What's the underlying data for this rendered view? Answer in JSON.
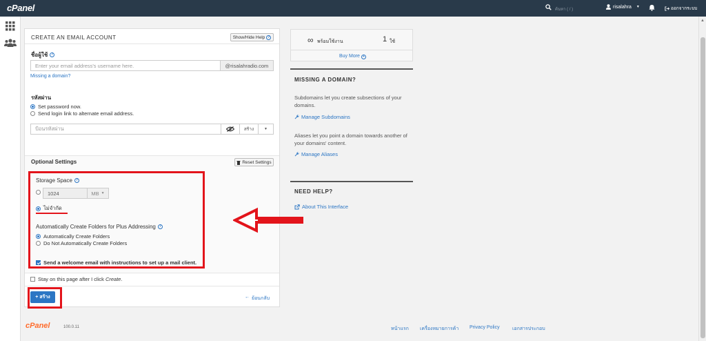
{
  "topbar": {
    "logo": "cPanel",
    "search_placeholder": "ค้นหา ( / )",
    "username": "risalahra",
    "logout": "ออกจากระบบ"
  },
  "form": {
    "title": "CREATE AN EMAIL ACCOUNT",
    "show_hide_help": "Show/Hide Help",
    "username_label": "ชื่อผู้ใช้",
    "username_placeholder": "Enter your email address's username here.",
    "domain": "@risalahradio.com",
    "missing_domain_link": "Missing a domain?",
    "password_label": "รหัสผ่าน",
    "set_password_now": "Set password now.",
    "send_login_link": "Send login link to alternate email address.",
    "password_placeholder": "ป้อนรหัสผ่าน",
    "generate_label": "สร้าง",
    "optional_settings": "Optional Settings",
    "reset_settings": "Reset Settings",
    "storage_label": "Storage Space",
    "storage_value": "1024",
    "storage_unit": "MB",
    "unlimited_label": "ไม่จำกัด",
    "auto_folders_label": "Automatically Create Folders for Plus Addressing",
    "auto_create": "Automatically Create Folders",
    "no_auto_create": "Do Not Automatically Create Folders",
    "welcome_email": "Send a welcome email with instructions to set up a mail client.",
    "stay_on_page_prefix": "Stay on this page after I click ",
    "stay_on_page_em": "Create",
    "stay_on_page_suffix": ".",
    "create_button": "สร้าง",
    "back_link": "ย้อนกลับ"
  },
  "sidebar": {
    "available_label": "พร้อมใช้งาน",
    "used_count": "1",
    "used_unit": "ใช้",
    "buy_more": "Buy More",
    "missing_domain_head": "MISSING A DOMAIN?",
    "subdomains_text": "Subdomains let you create subsections of your domains.",
    "manage_subdomains": "Manage Subdomains",
    "aliases_text": "Aliases let you point a domain towards another of your domains' content.",
    "manage_aliases": "Manage Aliases",
    "need_help_head": "NEED HELP?",
    "about_interface": "About This Interface"
  },
  "footer": {
    "logo": "cPanel",
    "version": "100.0.11",
    "links": [
      "หน้าแรก",
      "เครื่องหมายการค้า",
      "Privacy Policy",
      "เอกสารประกอบ"
    ]
  },
  "colors": {
    "topbar": "#293a4a",
    "primary": "#2c76c4",
    "annotation": "#e3141b",
    "brand_footer": "#ff6c2c"
  }
}
